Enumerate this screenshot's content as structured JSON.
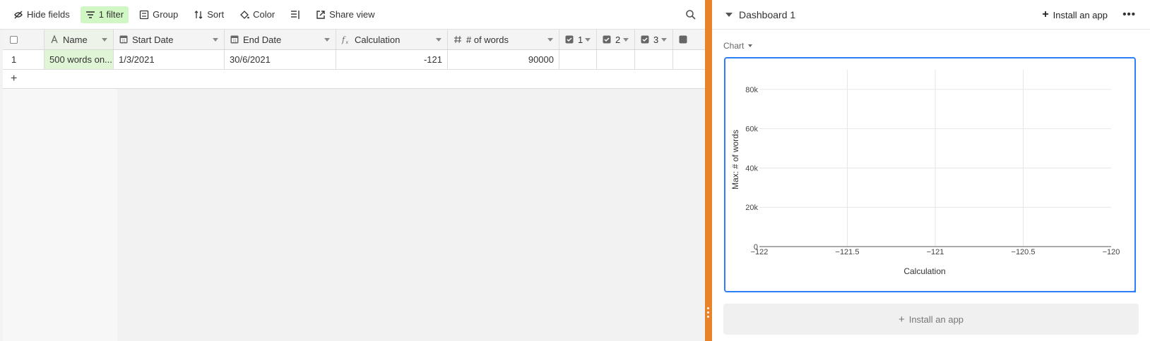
{
  "toolbar": {
    "hide_fields": "Hide fields",
    "filter": "1 filter",
    "group": "Group",
    "sort": "Sort",
    "color": "Color",
    "share_view": "Share view"
  },
  "grid": {
    "columns": [
      {
        "label": "Name",
        "icon": "text-field-icon"
      },
      {
        "label": "Start Date",
        "icon": "date-field-icon"
      },
      {
        "label": "End Date",
        "icon": "date-field-icon"
      },
      {
        "label": "Calculation",
        "icon": "formula-field-icon"
      },
      {
        "label": "# of words",
        "icon": "number-field-icon"
      },
      {
        "label": "1",
        "icon": "checkbox-field-icon"
      },
      {
        "label": "2",
        "icon": "checkbox-field-icon"
      },
      {
        "label": "3",
        "icon": "checkbox-field-icon"
      }
    ],
    "rows": [
      {
        "row_number": "1",
        "name": "500 words on...",
        "start_date": "1/3/2021",
        "end_date": "30/6/2021",
        "calculation": "-121",
        "words": "90000"
      }
    ],
    "add_row": "+"
  },
  "dashboard": {
    "title": "Dashboard 1",
    "install_app": "Install an app",
    "more": "•••",
    "chart_label": "Chart",
    "install_app_bottom": "Install an app"
  },
  "colors": {
    "divider": "#e8832a",
    "chart_border": "#2d7ff9",
    "filter_active": "#d1f7c4",
    "name_cell": "#e0f5d5"
  },
  "chart_data": {
    "type": "scatter",
    "xlabel": "Calculation",
    "ylabel": "Max: # of words",
    "xlim": [
      -122,
      -120
    ],
    "ylim": [
      0,
      90000
    ],
    "x_ticks": [
      -122,
      -121.5,
      -121,
      -120.5,
      -120
    ],
    "x_tick_labels": [
      "−122",
      "−121.5",
      "−121",
      "−120.5",
      "−120"
    ],
    "y_ticks": [
      0,
      20000,
      40000,
      60000,
      80000
    ],
    "y_tick_labels": [
      "0",
      "20k",
      "40k",
      "60k",
      "80k"
    ],
    "grid": true,
    "series": [
      {
        "x": [],
        "y": []
      }
    ]
  }
}
